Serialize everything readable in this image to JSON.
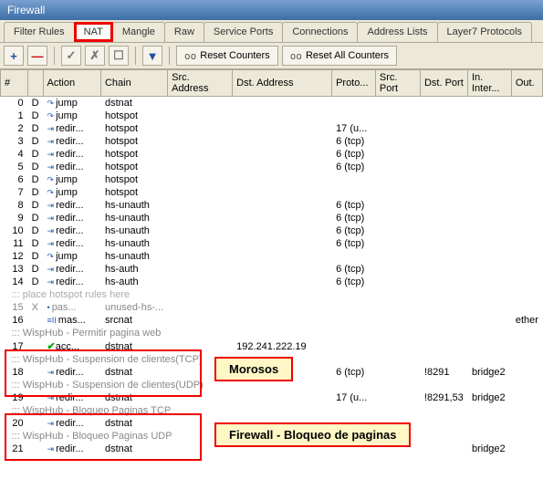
{
  "window": {
    "title": "Firewall"
  },
  "tabs": [
    "Filter Rules",
    "NAT",
    "Mangle",
    "Raw",
    "Service Ports",
    "Connections",
    "Address Lists",
    "Layer7 Protocols"
  ],
  "active_tab_index": 1,
  "toolbar": {
    "add": "+",
    "remove": "—",
    "enable": "✓",
    "disable": "✗",
    "comment": "☐",
    "filter": "▾",
    "reset": "Reset Counters",
    "reset_all": "Reset All Counters",
    "oo": "oo"
  },
  "columns": [
    "#",
    "",
    "Action",
    "Chain",
    "Src. Address",
    "Dst. Address",
    "Proto...",
    "Src. Port",
    "Dst. Port",
    "In. Inter...",
    "Out."
  ],
  "rows": [
    {
      "n": "0",
      "f": "D",
      "act": "jump",
      "chain": "dstnat"
    },
    {
      "n": "1",
      "f": "D",
      "act": "jump",
      "chain": "hotspot"
    },
    {
      "n": "2",
      "f": "D",
      "act": "redir...",
      "chain": "hotspot",
      "proto": "17 (u..."
    },
    {
      "n": "3",
      "f": "D",
      "act": "redir...",
      "chain": "hotspot",
      "proto": "6 (tcp)"
    },
    {
      "n": "4",
      "f": "D",
      "act": "redir...",
      "chain": "hotspot",
      "proto": "6 (tcp)"
    },
    {
      "n": "5",
      "f": "D",
      "act": "redir...",
      "chain": "hotspot",
      "proto": "6 (tcp)"
    },
    {
      "n": "6",
      "f": "D",
      "act": "jump",
      "chain": "hotspot"
    },
    {
      "n": "7",
      "f": "D",
      "act": "jump",
      "chain": "hotspot"
    },
    {
      "n": "8",
      "f": "D",
      "act": "redir...",
      "chain": "hs-unauth",
      "proto": "6 (tcp)"
    },
    {
      "n": "9",
      "f": "D",
      "act": "redir...",
      "chain": "hs-unauth",
      "proto": "6 (tcp)"
    },
    {
      "n": "10",
      "f": "D",
      "act": "redir...",
      "chain": "hs-unauth",
      "proto": "6 (tcp)"
    },
    {
      "n": "11",
      "f": "D",
      "act": "redir...",
      "chain": "hs-unauth",
      "proto": "6 (tcp)"
    },
    {
      "n": "12",
      "f": "D",
      "act": "jump",
      "chain": "hs-unauth"
    },
    {
      "n": "13",
      "f": "D",
      "act": "redir...",
      "chain": "hs-auth",
      "proto": "6 (tcp)"
    },
    {
      "n": "14",
      "f": "D",
      "act": "redir...",
      "chain": "hs-auth",
      "proto": "6 (tcp)"
    }
  ],
  "comment_place": "::: place hotspot rules here",
  "row15": {
    "n": "15",
    "f": "X",
    "act": "pas...",
    "chain": "unused-hs-..."
  },
  "row16": {
    "n": "16",
    "act": "mas...",
    "chain": "srcnat",
    "out": "ether"
  },
  "c_permitir": "::: WispHub - Permitir pagina web",
  "row17": {
    "n": "17",
    "act": "acc...",
    "chain": "dstnat",
    "dst": "192.241.222.19",
    "green": true
  },
  "c_susp_tcp": "::: WispHub - Suspension de clientes(TCP)",
  "row18": {
    "n": "18",
    "act": "redir...",
    "chain": "dstnat",
    "proto": "6 (tcp)",
    "dport": "!8291",
    "iin": "bridge2"
  },
  "c_susp_udp": "::: WispHub - Suspension de clientes(UDP)",
  "row19": {
    "n": "19",
    "act": "redir...",
    "chain": "dstnat",
    "proto": "17 (u...",
    "dport": "!8291,53",
    "iin": "bridge2"
  },
  "c_bloq_tcp": "::: WispHub - Bloqueo Paginas TCP",
  "row20": {
    "n": "20",
    "act": "redir...",
    "chain": "dstnat"
  },
  "c_bloq_udp": "::: WispHub - Bloqueo Paginas UDP",
  "row21": {
    "n": "21",
    "act": "redir...",
    "chain": "dstnat",
    "iin": "bridge2"
  },
  "annotation": {
    "morosos": "Morosos",
    "firewall": "Firewall - Bloqueo de paginas"
  }
}
